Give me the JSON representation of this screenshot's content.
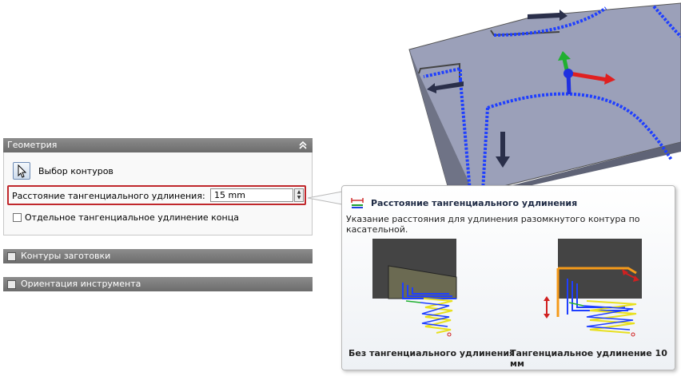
{
  "panel": {
    "geometry": {
      "title": "Геометрия",
      "select_contours_label": "Выбор контуров",
      "tangent_distance_label": "Расстояние тангенциального удлинения:",
      "tangent_distance_value": "15 mm",
      "separate_end_label": "Отдельное тангенциальное удлинение конца",
      "separate_end_checked": false
    },
    "stock_contours": {
      "title": "Контуры заготовки"
    },
    "tool_orientation": {
      "title": "Ориентация инструмента"
    }
  },
  "tooltip": {
    "title": "Расстояние тангенциального удлинения",
    "description": "Указание расстояния для удлинения разомкнутого контура по касательной.",
    "caption_left": "Без тангенциального удлинения",
    "caption_right": "Тангенциальное удлинение 10 мм"
  },
  "colors": {
    "header_bg": "#7a7a7a",
    "highlight_border": "#c0282c",
    "contour_blue": "#1f3fff",
    "extension_orange": "#f59a1a"
  }
}
